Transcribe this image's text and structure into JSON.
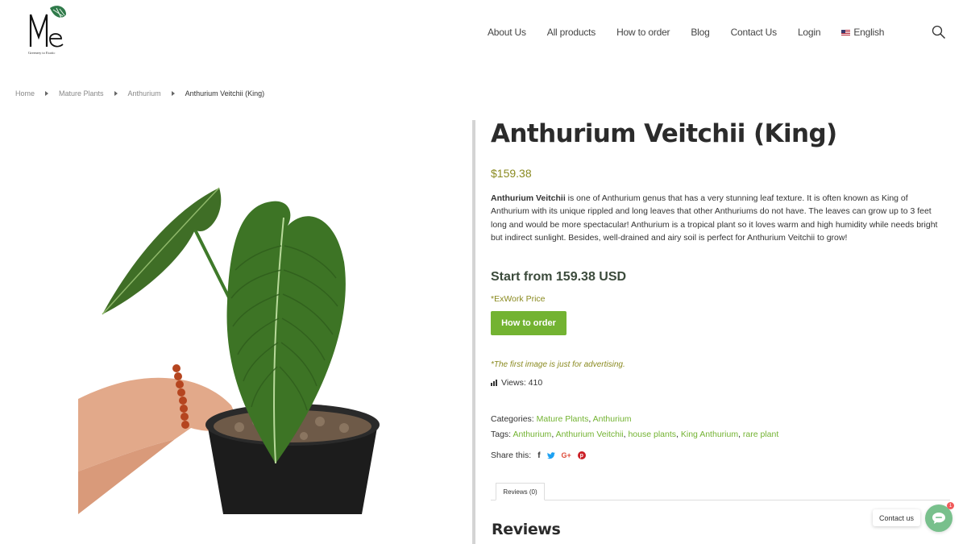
{
  "brand": {
    "logo_letters": "Me",
    "logo_tagline": "Greenery to Exotic"
  },
  "nav": {
    "items": [
      {
        "label": "About Us"
      },
      {
        "label": "All products"
      },
      {
        "label": "How to order"
      },
      {
        "label": "Blog"
      },
      {
        "label": "Contact Us"
      },
      {
        "label": "Login"
      }
    ],
    "language": "English"
  },
  "breadcrumb": [
    "Home",
    "Mature Plants",
    "Anthurium",
    "Anthurium Veitchii (King)"
  ],
  "product": {
    "title": "Anthurium Veitchii (King)",
    "price": "$159.38",
    "description_bold": "Anthurium Veitchii",
    "description_rest": " is one of Anthurium genus that has a very stunning leaf texture. It is often known as King of Anthurium with its unique rippled and long leaves that other Anthuriums do not have. The leaves can grow up to 3 feet long and would be more spectacular! Anthurium is a tropical plant so it loves warm and high humidity while needs bright but indirect sunlight. Besides, well-drained and airy soil is perfect for Anthurium Veitchii to grow!",
    "start_from": "Start from 159.38 USD",
    "exwork": "*ExWork Price",
    "order_button": "How to order",
    "note": "*The first image is just for advertising.",
    "views": "Views: 410",
    "categories_label": "Categories:",
    "categories": [
      "Mature Plants",
      "Anthurium"
    ],
    "tags_label": "Tags:",
    "tags": [
      "Anthurium",
      "Anthurium Veitchii",
      "house plants",
      "King Anthurium",
      "rare plant"
    ],
    "share_label": "Share this:"
  },
  "tabs": {
    "reviews_tab": "Reviews (0)",
    "reviews_heading": "Reviews"
  },
  "contact": {
    "label": "Contact us",
    "badge": "1"
  },
  "colors": {
    "accent_green": "#73b332",
    "price_olive": "#8a8a20",
    "contact_green": "#78c08c"
  }
}
